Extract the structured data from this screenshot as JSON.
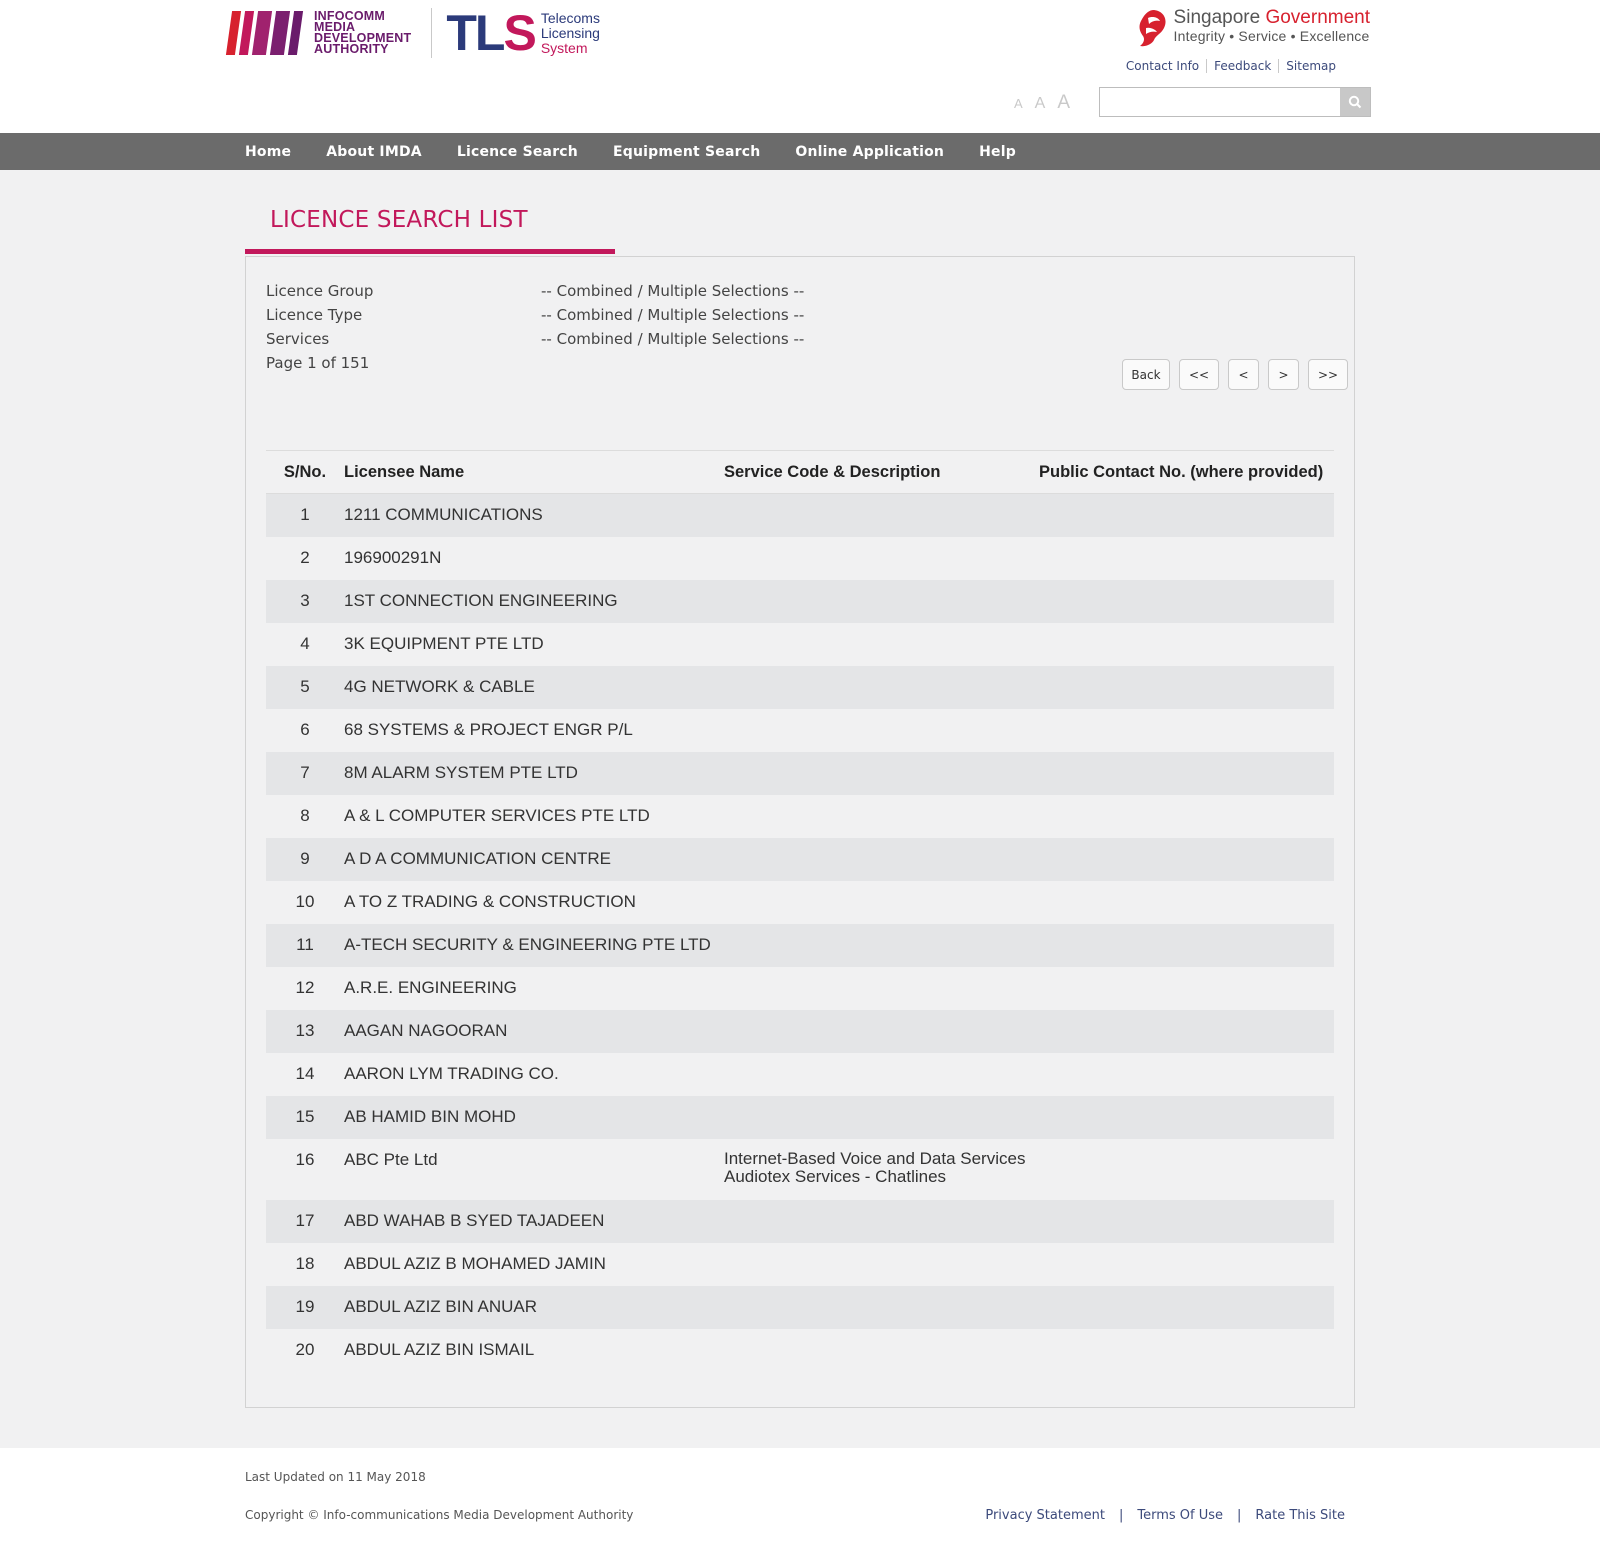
{
  "header": {
    "imda_lines": [
      "INFOCOMM",
      "MEDIA",
      "DEVELOPMENT",
      "AUTHORITY"
    ],
    "tls_word": "TLS",
    "tls_sub": [
      "Telecoms",
      "Licensing",
      "System"
    ],
    "gov_title_prefix": "Singapore",
    "gov_title_suffix": "Government",
    "gov_motto": "Integrity  •  Service  • Excellence",
    "util_links": [
      "Contact Info",
      "Feedback",
      "Sitemap"
    ],
    "font_sizes": [
      "A",
      "A",
      "A"
    ],
    "search_placeholder": ""
  },
  "nav": [
    "Home",
    "About IMDA",
    "Licence Search",
    "Equipment Search",
    "Online Application",
    "Help"
  ],
  "page_title": "LICENCE SEARCH LIST",
  "criteria": [
    {
      "label": "Licence Group",
      "value": "-- Combined / Multiple Selections --"
    },
    {
      "label": "Licence Type",
      "value": "-- Combined / Multiple Selections --"
    },
    {
      "label": "Services",
      "value": "-- Combined / Multiple Selections --"
    }
  ],
  "page_info": "Page 1 of 151",
  "pager": {
    "back": "Back",
    "first": "<<",
    "prev": "<",
    "next": ">",
    "last": ">>"
  },
  "table": {
    "headers": [
      "S/No.",
      "Licensee Name",
      "Service Code & Description",
      "Public Contact No. (where provided)"
    ],
    "rows": [
      {
        "sn": "1",
        "name": "1211 COMMUNICATIONS",
        "svc1": "",
        "svc2": "",
        "contact": ""
      },
      {
        "sn": "2",
        "name": "196900291N",
        "svc1": "",
        "svc2": "",
        "contact": ""
      },
      {
        "sn": "3",
        "name": "1ST CONNECTION ENGINEERING",
        "svc1": "",
        "svc2": "",
        "contact": ""
      },
      {
        "sn": "4",
        "name": "3K EQUIPMENT PTE LTD",
        "svc1": "",
        "svc2": "",
        "contact": ""
      },
      {
        "sn": "5",
        "name": "4G NETWORK & CABLE",
        "svc1": "",
        "svc2": "",
        "contact": ""
      },
      {
        "sn": "6",
        "name": "68 SYSTEMS & PROJECT ENGR P/L",
        "svc1": "",
        "svc2": "",
        "contact": ""
      },
      {
        "sn": "7",
        "name": "8M ALARM SYSTEM PTE LTD",
        "svc1": "",
        "svc2": "",
        "contact": ""
      },
      {
        "sn": "8",
        "name": "A & L COMPUTER SERVICES PTE LTD",
        "svc1": "",
        "svc2": "",
        "contact": ""
      },
      {
        "sn": "9",
        "name": "A D A COMMUNICATION CENTRE",
        "svc1": "",
        "svc2": "",
        "contact": ""
      },
      {
        "sn": "10",
        "name": "A TO Z TRADING & CONSTRUCTION",
        "svc1": "",
        "svc2": "",
        "contact": ""
      },
      {
        "sn": "11",
        "name": "A-TECH SECURITY & ENGINEERING PTE LTD",
        "svc1": "",
        "svc2": "",
        "contact": ""
      },
      {
        "sn": "12",
        "name": "A.R.E. ENGINEERING",
        "svc1": "",
        "svc2": "",
        "contact": ""
      },
      {
        "sn": "13",
        "name": "AAGAN NAGOORAN",
        "svc1": "",
        "svc2": "",
        "contact": ""
      },
      {
        "sn": "14",
        "name": "AARON LYM TRADING CO.",
        "svc1": "",
        "svc2": "",
        "contact": ""
      },
      {
        "sn": "15",
        "name": "AB HAMID BIN MOHD",
        "svc1": "",
        "svc2": "",
        "contact": ""
      },
      {
        "sn": "16",
        "name": "ABC Pte Ltd",
        "svc1": "Internet-Based Voice and Data Services",
        "svc2": "Audiotex Services - Chatlines",
        "contact": ""
      },
      {
        "sn": "17",
        "name": "ABD WAHAB B SYED TAJADEEN",
        "svc1": "",
        "svc2": "",
        "contact": ""
      },
      {
        "sn": "18",
        "name": "ABDUL AZIZ B MOHAMED JAMIN",
        "svc1": "",
        "svc2": "",
        "contact": ""
      },
      {
        "sn": "19",
        "name": "ABDUL AZIZ BIN ANUAR",
        "svc1": "",
        "svc2": "",
        "contact": ""
      },
      {
        "sn": "20",
        "name": "ABDUL AZIZ BIN ISMAIL",
        "svc1": "",
        "svc2": "",
        "contact": ""
      }
    ]
  },
  "footer": {
    "last_updated": "Last Updated on 11 May 2018",
    "copyright": "Copyright © Info-communications Media Development Authority",
    "links": [
      "Privacy Statement",
      "Terms Of Use",
      "Rate This Site"
    ],
    "separator": "|"
  },
  "colors": {
    "brand_pink": "#c2185b",
    "brand_navy": "#2b3a7a",
    "nav_bg": "#6b6b6b",
    "gov_red": "#d7212e"
  }
}
